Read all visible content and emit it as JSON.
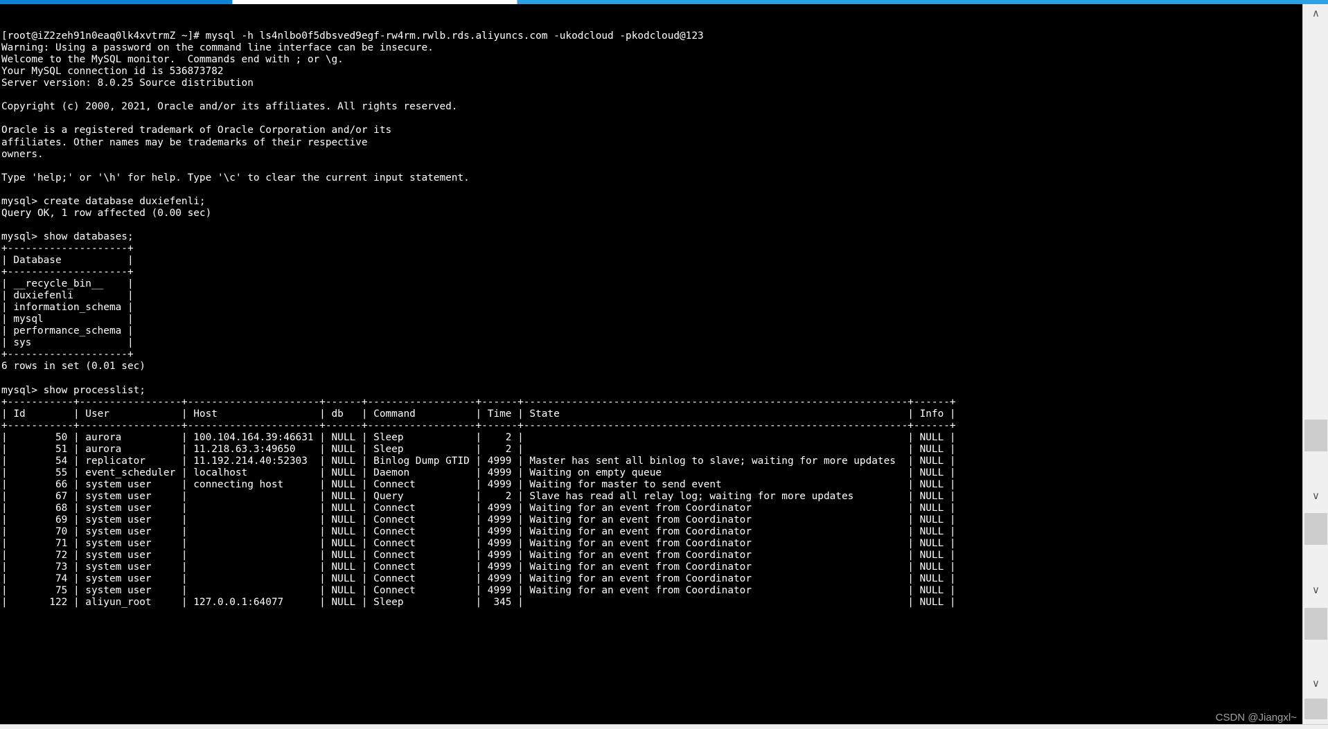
{
  "window": {
    "chrome_color": "#0a84d8",
    "terminal_bg": "#000000",
    "terminal_fg": "#ffffff"
  },
  "watermark": {
    "text": "CSDN @Jiangxl~"
  },
  "scrollbar": {
    "up_arrow": "∧",
    "down_arrow": "∨"
  },
  "terminal": {
    "prompt_user_host": "[root@iZ2zeh91n0eaq0lk4xvtrmZ ~]#",
    "lines": [
      "[root@iZ2zeh91n0eaq0lk4xvtrmZ ~]# mysql -h ls4nlbo0f5dbsved9egf-rw4rm.rwlb.rds.aliyuncs.com -ukodcloud -pkodcloud@123",
      "Warning: Using a password on the command line interface can be insecure.",
      "Welcome to the MySQL monitor.  Commands end with ; or \\g.",
      "Your MySQL connection id is 536873782",
      "Server version: 8.0.25 Source distribution",
      "",
      "Copyright (c) 2000, 2021, Oracle and/or its affiliates. All rights reserved.",
      "",
      "Oracle is a registered trademark of Oracle Corporation and/or its",
      "affiliates. Other names may be trademarks of their respective",
      "owners.",
      "",
      "Type 'help;' or '\\h' for help. Type '\\c' to clear the current input statement.",
      "",
      "mysql> create database duxiefenli;",
      "Query OK, 1 row affected (0.00 sec)",
      "",
      "mysql> show databases;",
      "+--------------------+",
      "| Database           |",
      "+--------------------+",
      "| __recycle_bin__    |",
      "| duxiefenli         |",
      "| information_schema |",
      "| mysql              |",
      "| performance_schema |",
      "| sys                |",
      "+--------------------+",
      "6 rows in set (0.01 sec)",
      "",
      "mysql> show processlist;",
      "+-----------+-----------------+----------------------+------+------------------+------+----------------------------------------------------------------+------+",
      "| Id        | User            | Host                 | db   | Command          | Time | State                                                          | Info |",
      "+-----------+-----------------+----------------------+------+------------------+------+----------------------------------------------------------------+------+",
      "|        50 | aurora          | 100.104.164.39:46631 | NULL | Sleep            |    2 |                                                                | NULL |",
      "|        51 | aurora          | 11.218.63.3:49650    | NULL | Sleep            |    2 |                                                                | NULL |",
      "|        54 | replicator      | 11.192.214.40:52303  | NULL | Binlog Dump GTID | 4999 | Master has sent all binlog to slave; waiting for more updates  | NULL |",
      "|        55 | event_scheduler | localhost            | NULL | Daemon           | 4999 | Waiting on empty queue                                         | NULL |",
      "|        66 | system user     | connecting host      | NULL | Connect          | 4999 | Waiting for master to send event                               | NULL |",
      "|        67 | system user     |                      | NULL | Query            |    2 | Slave has read all relay log; waiting for more updates         | NULL |",
      "|        68 | system user     |                      | NULL | Connect          | 4999 | Waiting for an event from Coordinator                          | NULL |",
      "|        69 | system user     |                      | NULL | Connect          | 4999 | Waiting for an event from Coordinator                          | NULL |",
      "|        70 | system user     |                      | NULL | Connect          | 4999 | Waiting for an event from Coordinator                          | NULL |",
      "|        71 | system user     |                      | NULL | Connect          | 4999 | Waiting for an event from Coordinator                          | NULL |",
      "|        72 | system user     |                      | NULL | Connect          | 4999 | Waiting for an event from Coordinator                          | NULL |",
      "|        73 | system user     |                      | NULL | Connect          | 4999 | Waiting for an event from Coordinator                          | NULL |",
      "|        74 | system user     |                      | NULL | Connect          | 4999 | Waiting for an event from Coordinator                          | NULL |",
      "|        75 | system user     |                      | NULL | Connect          | 4999 | Waiting for an event from Coordinator                          | NULL |",
      "|       122 | aliyun_root     | 127.0.0.1:64077      | NULL | Sleep            |  345 |                                                                | NULL |"
    ],
    "commands": [
      "mysql -h ls4nlbo0f5dbsved9egf-rw4rm.rwlb.rds.aliyuncs.com -ukodcloud -pkodcloud@123",
      "create database duxiefenli;",
      "show databases;",
      "show processlist;"
    ],
    "mysql_banner": {
      "warning": "Warning: Using a password on the command line interface can be insecure.",
      "welcome": "Welcome to the MySQL monitor.  Commands end with ; or \\g.",
      "connection_id": "Your MySQL connection id is 536873782",
      "server_version": "Server version: 8.0.25 Source distribution",
      "copyright": "Copyright (c) 2000, 2021, Oracle and/or its affiliates. All rights reserved.",
      "trademark_1": "Oracle is a registered trademark of Oracle Corporation and/or its",
      "trademark_2": "affiliates. Other names may be trademarks of their respective",
      "trademark_3": "owners.",
      "help_hint": "Type 'help;' or '\\h' for help. Type '\\c' to clear the current input statement."
    },
    "create_db_result": "Query OK, 1 row affected (0.00 sec)",
    "databases": {
      "column": "Database",
      "rows": [
        "__recycle_bin__",
        "duxiefenli",
        "information_schema",
        "mysql",
        "performance_schema",
        "sys"
      ],
      "footer": "6 rows in set (0.01 sec)"
    },
    "processlist": {
      "columns": [
        "Id",
        "User",
        "Host",
        "db",
        "Command",
        "Time",
        "State",
        "Info"
      ],
      "rows": [
        {
          "Id": "50",
          "User": "aurora",
          "Host": "100.104.164.39:46631",
          "db": "NULL",
          "Command": "Sleep",
          "Time": "2",
          "State": "",
          "Info": "NULL"
        },
        {
          "Id": "51",
          "User": "aurora",
          "Host": "11.218.63.3:49650",
          "db": "NULL",
          "Command": "Sleep",
          "Time": "2",
          "State": "",
          "Info": "NULL"
        },
        {
          "Id": "54",
          "User": "replicator",
          "Host": "11.192.214.40:52303",
          "db": "NULL",
          "Command": "Binlog Dump GTID",
          "Time": "4999",
          "State": "Master has sent all binlog to slave; waiting for more updates",
          "Info": "NULL"
        },
        {
          "Id": "55",
          "User": "event_scheduler",
          "Host": "localhost",
          "db": "NULL",
          "Command": "Daemon",
          "Time": "4999",
          "State": "Waiting on empty queue",
          "Info": "NULL"
        },
        {
          "Id": "66",
          "User": "system user",
          "Host": "connecting host",
          "db": "NULL",
          "Command": "Connect",
          "Time": "4999",
          "State": "Waiting for master to send event",
          "Info": "NULL"
        },
        {
          "Id": "67",
          "User": "system user",
          "Host": "",
          "db": "NULL",
          "Command": "Query",
          "Time": "2",
          "State": "Slave has read all relay log; waiting for more updates",
          "Info": "NULL"
        },
        {
          "Id": "68",
          "User": "system user",
          "Host": "",
          "db": "NULL",
          "Command": "Connect",
          "Time": "4999",
          "State": "Waiting for an event from Coordinator",
          "Info": "NULL"
        },
        {
          "Id": "69",
          "User": "system user",
          "Host": "",
          "db": "NULL",
          "Command": "Connect",
          "Time": "4999",
          "State": "Waiting for an event from Coordinator",
          "Info": "NULL"
        },
        {
          "Id": "70",
          "User": "system user",
          "Host": "",
          "db": "NULL",
          "Command": "Connect",
          "Time": "4999",
          "State": "Waiting for an event from Coordinator",
          "Info": "NULL"
        },
        {
          "Id": "71",
          "User": "system user",
          "Host": "",
          "db": "NULL",
          "Command": "Connect",
          "Time": "4999",
          "State": "Waiting for an event from Coordinator",
          "Info": "NULL"
        },
        {
          "Id": "72",
          "User": "system user",
          "Host": "",
          "db": "NULL",
          "Command": "Connect",
          "Time": "4999",
          "State": "Waiting for an event from Coordinator",
          "Info": "NULL"
        },
        {
          "Id": "73",
          "User": "system user",
          "Host": "",
          "db": "NULL",
          "Command": "Connect",
          "Time": "4999",
          "State": "Waiting for an event from Coordinator",
          "Info": "NULL"
        },
        {
          "Id": "74",
          "User": "system user",
          "Host": "",
          "db": "NULL",
          "Command": "Connect",
          "Time": "4999",
          "State": "Waiting for an event from Coordinator",
          "Info": "NULL"
        },
        {
          "Id": "75",
          "User": "system user",
          "Host": "",
          "db": "NULL",
          "Command": "Connect",
          "Time": "4999",
          "State": "Waiting for an event from Coordinator",
          "Info": "NULL"
        },
        {
          "Id": "122",
          "User": "aliyun_root",
          "Host": "127.0.0.1:64077",
          "db": "NULL",
          "Command": "Sleep",
          "Time": "345",
          "State": "",
          "Info": "NULL"
        }
      ]
    }
  }
}
